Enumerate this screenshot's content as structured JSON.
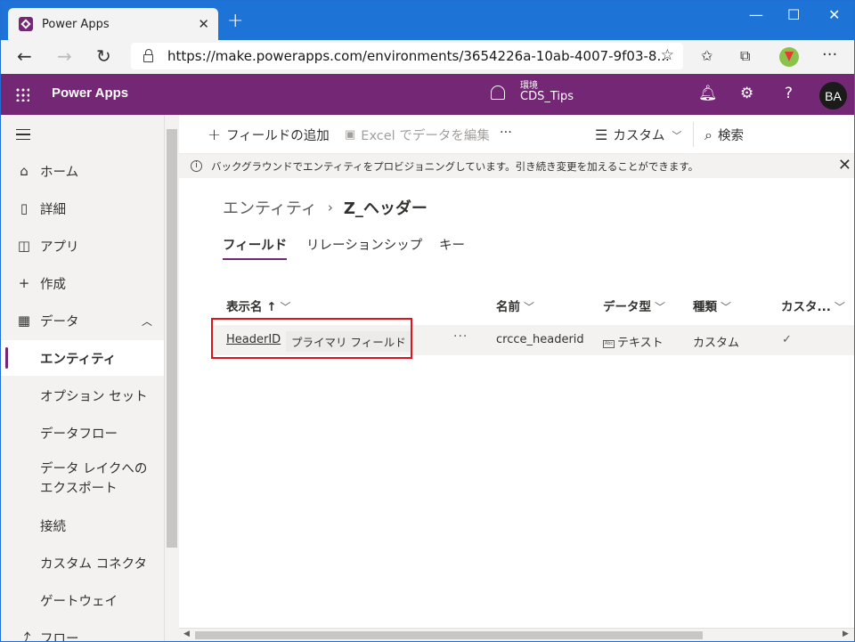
{
  "browser": {
    "tab_title": "Power Apps",
    "url": "https://make.powerapps.com/environments/3654226a-10ab-4007-9f03-8...",
    "new_tab": "+",
    "minimize": "—",
    "maximize": "☐",
    "close": "✕"
  },
  "app": {
    "name": "Power Apps",
    "env_label": "環境",
    "env_name": "CDS_Tips",
    "avatar": "BA"
  },
  "sidebar": {
    "items": [
      {
        "label": "ホーム",
        "icon": "home-icon"
      },
      {
        "label": "詳細",
        "icon": "book-icon"
      },
      {
        "label": "アプリ",
        "icon": "apps-icon"
      },
      {
        "label": "作成",
        "icon": "plus-icon"
      },
      {
        "label": "データ",
        "icon": "table-icon"
      },
      {
        "label": "エンティティ"
      },
      {
        "label": "オプション セット"
      },
      {
        "label": "データフロー"
      },
      {
        "label": "データ レイクへのエクスポート"
      },
      {
        "label": "接続"
      },
      {
        "label": "カスタム コネクタ"
      },
      {
        "label": "ゲートウェイ"
      },
      {
        "label": "フロー",
        "icon": "flow-icon"
      }
    ]
  },
  "command_bar": {
    "add_field": "フィールドの追加",
    "edit_excel": "Excel でデータを編集",
    "more": "···",
    "view": "カスタム",
    "search": "検索"
  },
  "banner": {
    "message": "バックグラウンドでエンティティをプロビジョニングしています。引き続き変更を加えることができます。"
  },
  "breadcrumb": {
    "root": "エンティティ",
    "separator": "›",
    "current": "Z_ヘッダー"
  },
  "tabs": [
    "フィールド",
    "リレーションシップ",
    "キー"
  ],
  "table": {
    "columns": [
      "表示名 ↑",
      "名前",
      "データ型",
      "種類",
      "カスタ..."
    ],
    "rows": [
      {
        "display_name": "HeaderID",
        "badge": "プライマリ フィールド",
        "more": "···",
        "name": "crcce_headerid",
        "type_icon": "Abc",
        "data_type": "テキスト",
        "kind": "カスタム",
        "custom": "✓"
      }
    ]
  },
  "colors": {
    "titlebar": "#1e73d6",
    "brand": "#742774",
    "highlight": "#e0121a"
  }
}
